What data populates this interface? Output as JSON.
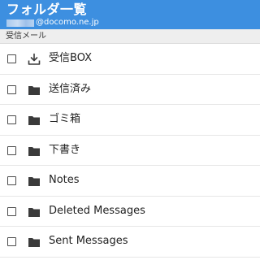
{
  "header": {
    "title": "フォルダ一覧",
    "account_suffix": "@docomo.ne.jp"
  },
  "section": {
    "label": "受信メール"
  },
  "folders": [
    {
      "label": "受信BOX",
      "icon": "inbox-download-icon",
      "checked": false
    },
    {
      "label": "送信済み",
      "icon": "folder-icon",
      "checked": false
    },
    {
      "label": "ゴミ箱",
      "icon": "folder-icon",
      "checked": false
    },
    {
      "label": "下書き",
      "icon": "folder-icon",
      "checked": false
    },
    {
      "label": "Notes",
      "icon": "folder-icon",
      "checked": false
    },
    {
      "label": "Deleted Messages",
      "icon": "folder-icon",
      "checked": false
    },
    {
      "label": "Sent Messages",
      "icon": "folder-icon",
      "checked": false
    }
  ],
  "colors": {
    "header_bg": "#3d8fe0",
    "section_bg": "#eeeeee",
    "icon": "#3a3a3a"
  }
}
